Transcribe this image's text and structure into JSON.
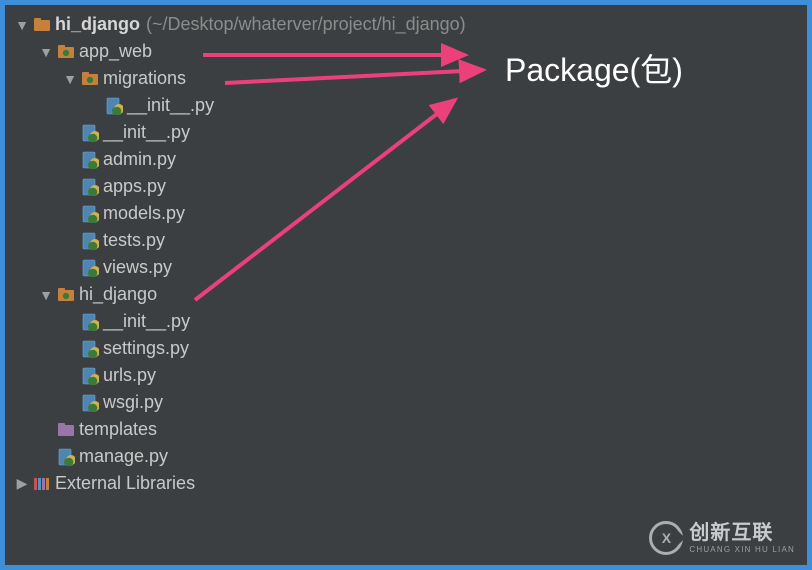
{
  "annotation": "Package(包)",
  "watermark": {
    "brand": "创新互联",
    "pinyin": "CHUANG XIN HU LIAN",
    "logo_letter": "X"
  },
  "tree": {
    "root": {
      "name": "hi_django",
      "path": "(~/Desktop/whaterver/project/hi_django)"
    },
    "app_web": {
      "name": "app_web",
      "migrations": {
        "name": "migrations",
        "init": "__init__.py"
      },
      "files": {
        "init": "__init__.py",
        "admin": "admin.py",
        "apps": "apps.py",
        "models": "models.py",
        "tests": "tests.py",
        "views": "views.py"
      }
    },
    "hi_django_pkg": {
      "name": "hi_django",
      "files": {
        "init": "__init__.py",
        "settings": "settings.py",
        "urls": "urls.py",
        "wsgi": "wsgi.py"
      }
    },
    "templates": "templates",
    "manage": "manage.py",
    "external_libs": "External Libraries"
  }
}
